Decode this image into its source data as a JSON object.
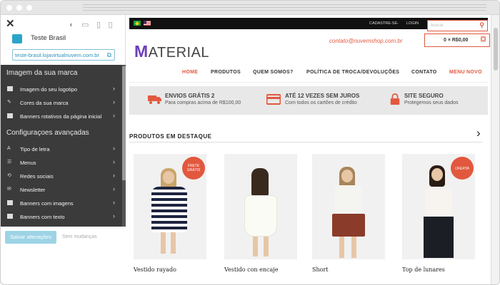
{
  "editor": {
    "store_name": "Teste Brasil",
    "store_url": "teste-brasil.lojavirtualnuvem.com.br",
    "brand_section": "Imagem da sua marca",
    "brand_items": [
      "Imagem do seu logotipo",
      "Cores da sua marca",
      "Banners rotativos da página inicial"
    ],
    "advanced_section": "Configuraçoes avançadas",
    "advanced_items": [
      "Tipo de letra",
      "Menus",
      "Redes sociais",
      "Newsletter",
      "Banners com imagens",
      "Banners com texto"
    ],
    "save_label": "Salvar alterações",
    "no_changes": "Sem mudanças"
  },
  "store": {
    "topbar": {
      "register": "CADASTRE-SE",
      "separator": "-",
      "login": "LOGIN",
      "search_placeholder": "buscar"
    },
    "logo": {
      "first": "M",
      "rest": "ATERIAL"
    },
    "email": "contato@nuvemshop.com.br",
    "cart": "0 × R$0,00",
    "nav": [
      "HOME",
      "PRODUTOS",
      "QUEM SOMOS?",
      "POLÍTICA DE TROCA/DEVOLUÇÕES",
      "CONTATO",
      "MENU NOVO"
    ],
    "features": [
      {
        "title": "ENVIOS GRÁTIS 2",
        "sub": "Para compras acima de R$100,00",
        "icon": "truck-icon"
      },
      {
        "title": "ATÉ 12 VEZES SEM JUROS",
        "sub": "Com todos os cartões de crédito",
        "icon": "credit-card-icon"
      },
      {
        "title": "SITE SEGURO",
        "sub": "Protegemos seus dados",
        "icon": "lock-icon"
      }
    ],
    "section_title": "PRODUTOS EM DESTAQUE",
    "products": [
      {
        "name": "Vestido rayado",
        "badge": "FRETE GRÁTIS"
      },
      {
        "name": "Vestido con encaje",
        "badge": ""
      },
      {
        "name": "Short",
        "badge": ""
      },
      {
        "name": "Top de lunares",
        "badge": "OFERTA"
      }
    ]
  },
  "colors": {
    "accent": "#e2583e",
    "logo": "#6e3fb8",
    "panel": "#3b3b3b",
    "link": "#2a93b6"
  }
}
